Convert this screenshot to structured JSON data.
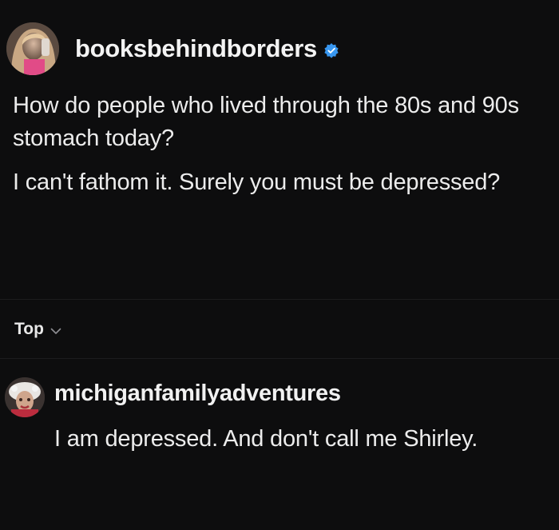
{
  "post": {
    "username": "booksbehindborders",
    "verified": true,
    "paragraphs": [
      "How do people who lived through the 80s and 90s stomach today?",
      "I can't fathom it. Surely you must be depressed?"
    ]
  },
  "sort": {
    "label": "Top"
  },
  "comments": [
    {
      "username": "michiganfamilyadventures",
      "text": "I am depressed. And don't call me Shirley."
    }
  ],
  "colors": {
    "background": "#0d0d0e",
    "text": "#ececec",
    "verified": "#3897f0",
    "muted": "#8e8e93"
  },
  "icons": {
    "verified": "verified-badge-icon",
    "sort": "chevron-down-icon"
  }
}
